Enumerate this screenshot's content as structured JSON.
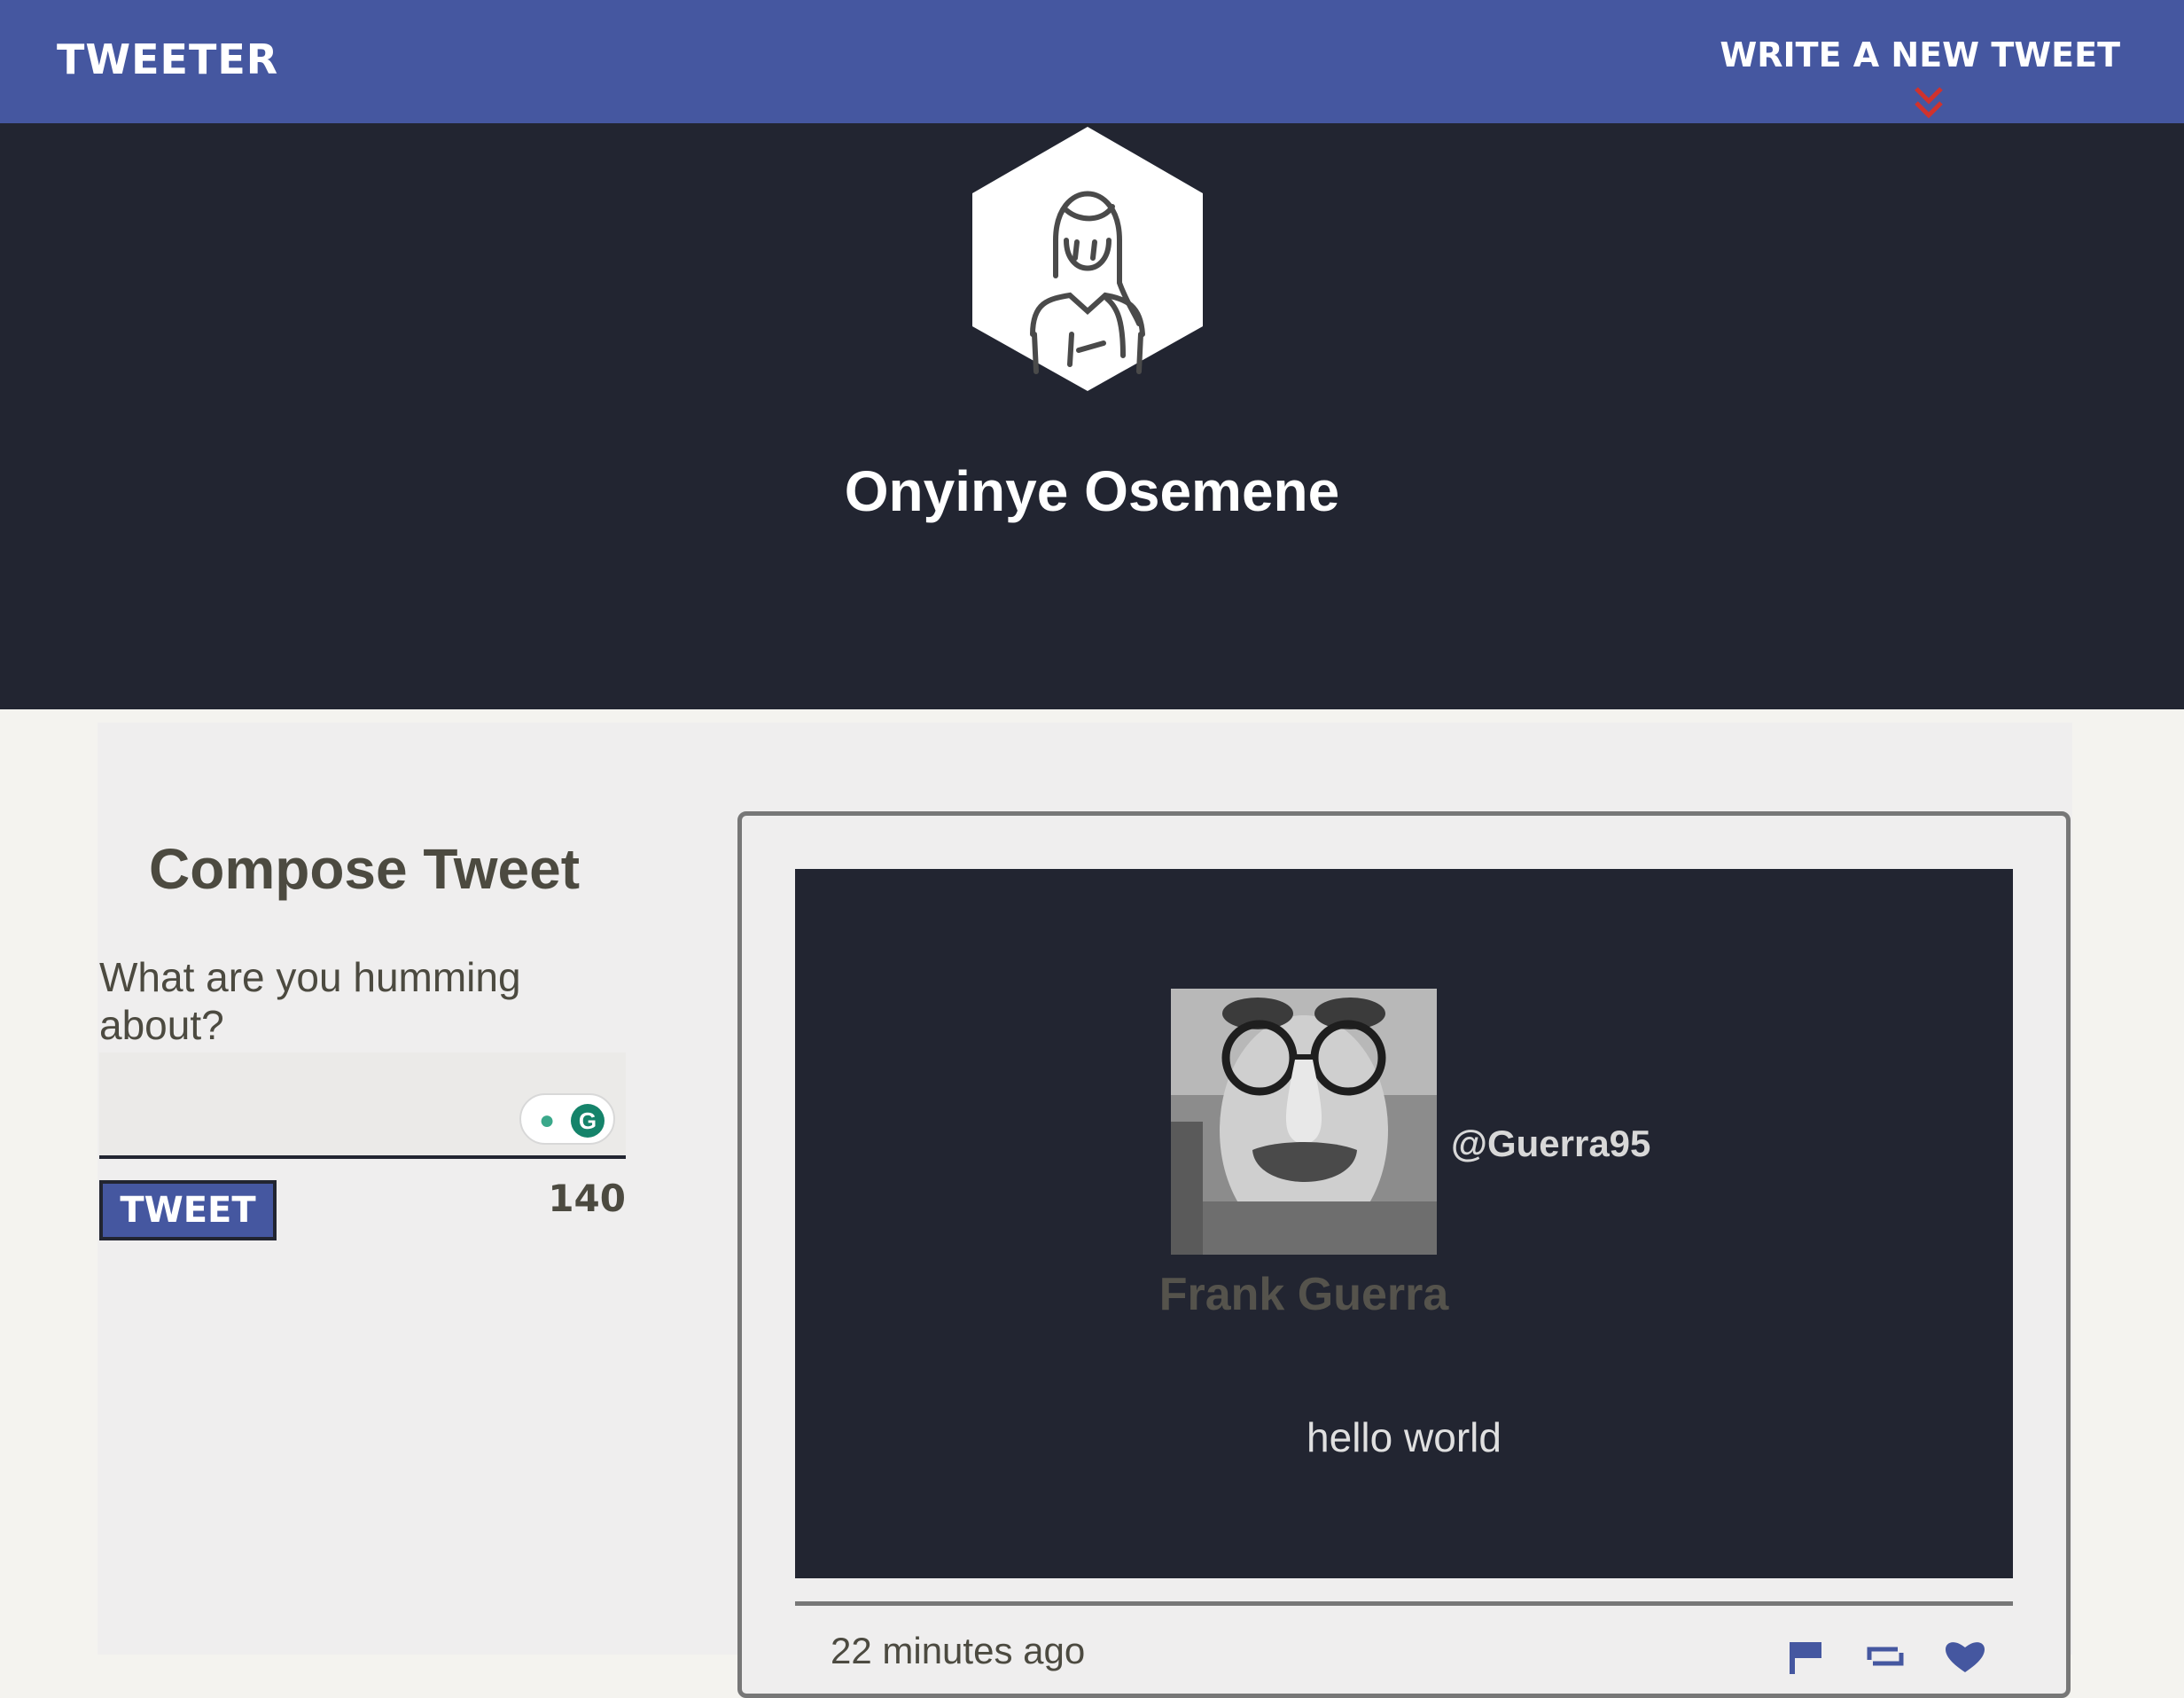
{
  "nav": {
    "brand": "Tweeter",
    "write_link": "Write a new tweet",
    "chevron_icon": "double-chevron-down-icon",
    "chevron_color": "#d0322d"
  },
  "profile": {
    "name": "Onyinye Osemene",
    "avatar_icon": "woman-outline-avatar-icon"
  },
  "compose": {
    "title": "Compose Tweet",
    "prompt": "What are you humming about?",
    "input_value": "",
    "button_label": "Tweet",
    "counter": "140",
    "widget_icons": [
      "lightbulb-icon",
      "grammarly-g-icon"
    ]
  },
  "tweet": {
    "handle": "@Guerra95",
    "author": "Frank Guerra",
    "content": "hello world",
    "time": "22 minutes ago",
    "action_icons": [
      "flag-icon",
      "retweet-icon",
      "heart-icon"
    ]
  },
  "colors": {
    "nav_bg": "#4557a0",
    "header_bg": "#222531",
    "page_bg": "#f4f3ef",
    "accent_red": "#d0322d"
  }
}
